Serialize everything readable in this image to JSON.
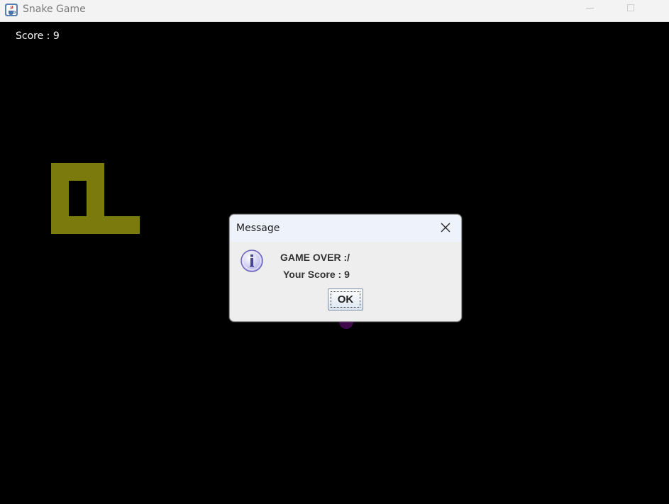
{
  "window": {
    "title": "Snake Game",
    "icon": "java-icon",
    "controls": [
      "minimize-icon",
      "maximize-icon"
    ]
  },
  "game": {
    "score_text": "Score : 9",
    "score": 9,
    "colors": {
      "background": "#000000",
      "snake": "#7a7a0d",
      "food": "#3f0a4a"
    },
    "snake_cells": [
      [
        0,
        0
      ],
      [
        1,
        0
      ],
      [
        2,
        0
      ],
      [
        0,
        1
      ],
      [
        2,
        1
      ],
      [
        0,
        2
      ],
      [
        2,
        2
      ],
      [
        0,
        3
      ],
      [
        1,
        3
      ],
      [
        2,
        3
      ],
      [
        3,
        3
      ],
      [
        4,
        3
      ]
    ]
  },
  "dialog": {
    "title": "Message",
    "icon": "info-icon",
    "line1": "GAME OVER :/",
    "line2": "Your Score : 9",
    "ok_label": "OK"
  }
}
